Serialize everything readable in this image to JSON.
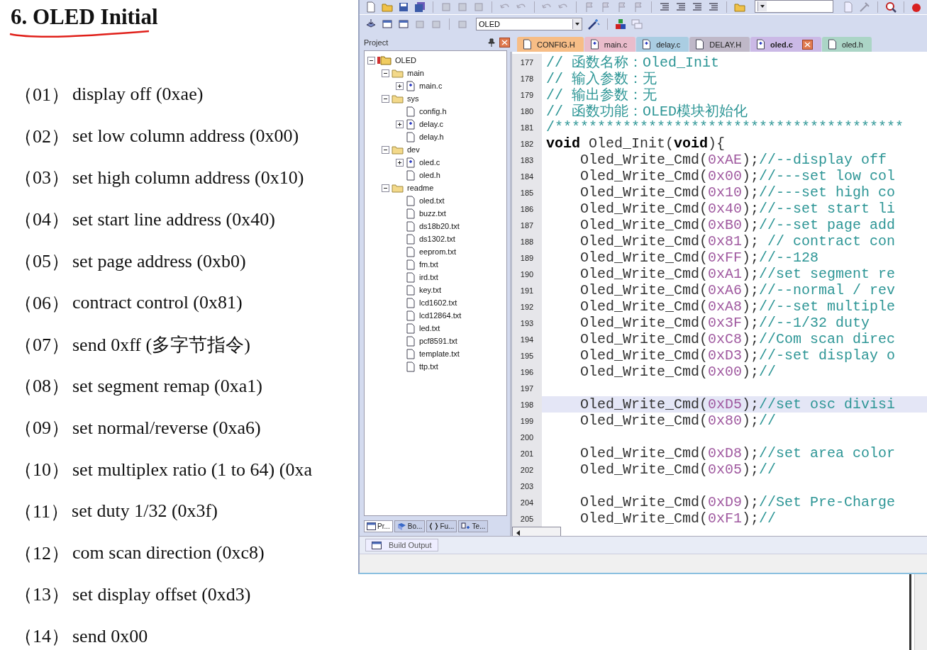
{
  "document": {
    "title": "6. OLED Initial",
    "items": [
      {
        "index": "（01）",
        "text": "display off (0xae)"
      },
      {
        "index": "（02）",
        "text": "set low column address (0x00)"
      },
      {
        "index": "（03）",
        "text": "set high column address (0x10)"
      },
      {
        "index": "（04）",
        "text": "set start line address (0x40)"
      },
      {
        "index": "（05）",
        "text": "set page address (0xb0)"
      },
      {
        "index": "（06）",
        "text": "contract control (0x81)"
      },
      {
        "index": "（07）",
        "text": "send 0xff (多字节指令)"
      },
      {
        "index": "（08）",
        "text": "set segment remap (0xa1)"
      },
      {
        "index": "（09）",
        "text": "set normal/reverse (0xa6)"
      },
      {
        "index": "（10）",
        "text": "set multiplex ratio (1 to 64) (0xa"
      },
      {
        "index": "（11）",
        "text": "set duty 1/32 (0x3f)"
      },
      {
        "index": "（12）",
        "text": "com scan direction (0xc8)"
      },
      {
        "index": "（13）",
        "text": "set display offset (0xd3)"
      },
      {
        "index": "（14）",
        "text": "send 0x00"
      }
    ]
  },
  "ide": {
    "target": "OLED",
    "project": {
      "title": "Project",
      "tree": [
        {
          "label": "OLED",
          "kind": "target",
          "expanded": true,
          "children": [
            {
              "label": "main",
              "kind": "folder",
              "expanded": true,
              "children": [
                {
                  "label": "main.c",
                  "kind": "source",
                  "expanded": false
                }
              ]
            },
            {
              "label": "sys",
              "kind": "folder",
              "expanded": true,
              "children": [
                {
                  "label": "config.h",
                  "kind": "file"
                },
                {
                  "label": "delay.c",
                  "kind": "source",
                  "expanded": false
                },
                {
                  "label": "delay.h",
                  "kind": "file"
                }
              ]
            },
            {
              "label": "dev",
              "kind": "folder",
              "expanded": true,
              "children": [
                {
                  "label": "oled.c",
                  "kind": "source",
                  "expanded": false
                },
                {
                  "label": "oled.h",
                  "kind": "file"
                }
              ]
            },
            {
              "label": "readme",
              "kind": "folder",
              "expanded": true,
              "children": [
                {
                  "label": "oled.txt",
                  "kind": "file"
                },
                {
                  "label": "buzz.txt",
                  "kind": "file"
                },
                {
                  "label": "ds18b20.txt",
                  "kind": "file"
                },
                {
                  "label": "ds1302.txt",
                  "kind": "file"
                },
                {
                  "label": "eeprom.txt",
                  "kind": "file"
                },
                {
                  "label": "fm.txt",
                  "kind": "file"
                },
                {
                  "label": "ird.txt",
                  "kind": "file"
                },
                {
                  "label": "key.txt",
                  "kind": "file"
                },
                {
                  "label": "lcd1602.txt",
                  "kind": "file"
                },
                {
                  "label": "lcd12864.txt",
                  "kind": "file"
                },
                {
                  "label": "led.txt",
                  "kind": "file"
                },
                {
                  "label": "pcf8591.txt",
                  "kind": "file"
                },
                {
                  "label": "template.txt",
                  "kind": "file"
                },
                {
                  "label": "ttp.txt",
                  "kind": "file"
                }
              ]
            }
          ]
        }
      ],
      "tabs": [
        {
          "label": "Pr...",
          "kind": "project",
          "selected": true
        },
        {
          "label": "Bo...",
          "kind": "books",
          "selected": false
        },
        {
          "label": "Fu...",
          "kind": "functions",
          "selected": false
        },
        {
          "label": "Te...",
          "kind": "templates",
          "selected": false
        }
      ]
    },
    "tabs": [
      {
        "label": "CONFIG.H",
        "kind": "file",
        "color": "#f7bd86",
        "selected": false
      },
      {
        "label": "main.c",
        "kind": "source",
        "color": "#e9bccb",
        "selected": false
      },
      {
        "label": "delay.c",
        "kind": "source",
        "color": "#aacde2",
        "selected": false
      },
      {
        "label": "DELAY.H",
        "kind": "file",
        "color": "#bfb8c8",
        "selected": false
      },
      {
        "label": "oled.c",
        "kind": "source",
        "color": "#cbb9e6",
        "selected": true
      },
      {
        "label": "oled.h",
        "kind": "file",
        "color": "#abd5c6",
        "selected": false
      }
    ],
    "code": [
      {
        "n": "177",
        "selected": false,
        "parts": [
          {
            "kind": "comment",
            "text": "// 函数名称：Oled_Init"
          }
        ]
      },
      {
        "n": "178",
        "selected": false,
        "parts": [
          {
            "kind": "comment",
            "text": "// 输入参数：无"
          }
        ]
      },
      {
        "n": "179",
        "selected": false,
        "parts": [
          {
            "kind": "comment",
            "text": "// 输出参数：无"
          }
        ]
      },
      {
        "n": "180",
        "selected": false,
        "parts": [
          {
            "kind": "comment",
            "text": "// 函数功能：OLED模块初始化"
          }
        ]
      },
      {
        "n": "181",
        "selected": false,
        "parts": [
          {
            "kind": "comment",
            "text": "/*****************************************"
          }
        ]
      },
      {
        "n": "182",
        "selected": false,
        "parts": [
          {
            "kind": "keyword",
            "text": "void"
          },
          {
            "kind": "plain",
            "text": " Oled_Init("
          },
          {
            "kind": "keyword",
            "text": "void"
          },
          {
            "kind": "plain",
            "text": "){"
          }
        ]
      },
      {
        "n": "183",
        "selected": false,
        "parts": [
          {
            "kind": "plain",
            "text": "    Oled_Write_Cmd("
          },
          {
            "kind": "number",
            "text": "0xAE"
          },
          {
            "kind": "plain",
            "text": ");"
          },
          {
            "kind": "comment",
            "text": "//--display off"
          }
        ]
      },
      {
        "n": "184",
        "selected": false,
        "parts": [
          {
            "kind": "plain",
            "text": "    Oled_Write_Cmd("
          },
          {
            "kind": "number",
            "text": "0x00"
          },
          {
            "kind": "plain",
            "text": ");"
          },
          {
            "kind": "comment",
            "text": "//---set low col"
          }
        ]
      },
      {
        "n": "185",
        "selected": false,
        "parts": [
          {
            "kind": "plain",
            "text": "    Oled_Write_Cmd("
          },
          {
            "kind": "number",
            "text": "0x10"
          },
          {
            "kind": "plain",
            "text": ");"
          },
          {
            "kind": "comment",
            "text": "//---set high co"
          }
        ]
      },
      {
        "n": "186",
        "selected": false,
        "parts": [
          {
            "kind": "plain",
            "text": "    Oled_Write_Cmd("
          },
          {
            "kind": "number",
            "text": "0x40"
          },
          {
            "kind": "plain",
            "text": ");"
          },
          {
            "kind": "comment",
            "text": "//--set start li"
          }
        ]
      },
      {
        "n": "187",
        "selected": false,
        "parts": [
          {
            "kind": "plain",
            "text": "    Oled_Write_Cmd("
          },
          {
            "kind": "number",
            "text": "0xB0"
          },
          {
            "kind": "plain",
            "text": ");"
          },
          {
            "kind": "comment",
            "text": "//--set page add"
          }
        ]
      },
      {
        "n": "188",
        "selected": false,
        "parts": [
          {
            "kind": "plain",
            "text": "    Oled_Write_Cmd("
          },
          {
            "kind": "number",
            "text": "0x81"
          },
          {
            "kind": "plain",
            "text": "); "
          },
          {
            "kind": "comment",
            "text": "// contract con"
          }
        ]
      },
      {
        "n": "189",
        "selected": false,
        "parts": [
          {
            "kind": "plain",
            "text": "    Oled_Write_Cmd("
          },
          {
            "kind": "number",
            "text": "0xFF"
          },
          {
            "kind": "plain",
            "text": ");"
          },
          {
            "kind": "comment",
            "text": "//--128"
          }
        ]
      },
      {
        "n": "190",
        "selected": false,
        "parts": [
          {
            "kind": "plain",
            "text": "    Oled_Write_Cmd("
          },
          {
            "kind": "number",
            "text": "0xA1"
          },
          {
            "kind": "plain",
            "text": ");"
          },
          {
            "kind": "comment",
            "text": "//set segment re"
          }
        ]
      },
      {
        "n": "191",
        "selected": false,
        "parts": [
          {
            "kind": "plain",
            "text": "    Oled_Write_Cmd("
          },
          {
            "kind": "number",
            "text": "0xA6"
          },
          {
            "kind": "plain",
            "text": ");"
          },
          {
            "kind": "comment",
            "text": "//--normal / rev"
          }
        ]
      },
      {
        "n": "192",
        "selected": false,
        "parts": [
          {
            "kind": "plain",
            "text": "    Oled_Write_Cmd("
          },
          {
            "kind": "number",
            "text": "0xA8"
          },
          {
            "kind": "plain",
            "text": ");"
          },
          {
            "kind": "comment",
            "text": "//--set multiple"
          }
        ]
      },
      {
        "n": "193",
        "selected": false,
        "parts": [
          {
            "kind": "plain",
            "text": "    Oled_Write_Cmd("
          },
          {
            "kind": "number",
            "text": "0x3F"
          },
          {
            "kind": "plain",
            "text": ");"
          },
          {
            "kind": "comment",
            "text": "//--1/32 duty"
          }
        ]
      },
      {
        "n": "194",
        "selected": false,
        "parts": [
          {
            "kind": "plain",
            "text": "    Oled_Write_Cmd("
          },
          {
            "kind": "number",
            "text": "0xC8"
          },
          {
            "kind": "plain",
            "text": ");"
          },
          {
            "kind": "comment",
            "text": "//Com scan direc"
          }
        ]
      },
      {
        "n": "195",
        "selected": false,
        "parts": [
          {
            "kind": "plain",
            "text": "    Oled_Write_Cmd("
          },
          {
            "kind": "number",
            "text": "0xD3"
          },
          {
            "kind": "plain",
            "text": ");"
          },
          {
            "kind": "comment",
            "text": "//-set display o"
          }
        ]
      },
      {
        "n": "196",
        "selected": false,
        "parts": [
          {
            "kind": "plain",
            "text": "    Oled_Write_Cmd("
          },
          {
            "kind": "number",
            "text": "0x00"
          },
          {
            "kind": "plain",
            "text": ");"
          },
          {
            "kind": "comment",
            "text": "//"
          }
        ]
      },
      {
        "n": "197",
        "selected": false
      },
      {
        "n": "198",
        "selected": true,
        "parts": [
          {
            "kind": "plain",
            "text": "    Oled_Write_Cmd("
          },
          {
            "kind": "number",
            "text": "0xD5"
          },
          {
            "kind": "plain",
            "text": ");"
          },
          {
            "kind": "comment",
            "text": "//set osc divisi"
          }
        ]
      },
      {
        "n": "199",
        "selected": false,
        "parts": [
          {
            "kind": "plain",
            "text": "    Oled_Write_Cmd("
          },
          {
            "kind": "number",
            "text": "0x80"
          },
          {
            "kind": "plain",
            "text": ");"
          },
          {
            "kind": "comment",
            "text": "//"
          }
        ]
      },
      {
        "n": "200",
        "selected": false
      },
      {
        "n": "201",
        "selected": false,
        "parts": [
          {
            "kind": "plain",
            "text": "    Oled_Write_Cmd("
          },
          {
            "kind": "number",
            "text": "0xD8"
          },
          {
            "kind": "plain",
            "text": ");"
          },
          {
            "kind": "comment",
            "text": "//set area color"
          }
        ]
      },
      {
        "n": "202",
        "selected": false,
        "parts": [
          {
            "kind": "plain",
            "text": "    Oled_Write_Cmd("
          },
          {
            "kind": "number",
            "text": "0x05"
          },
          {
            "kind": "plain",
            "text": ");"
          },
          {
            "kind": "comment",
            "text": "//"
          }
        ]
      },
      {
        "n": "203",
        "selected": false
      },
      {
        "n": "204",
        "selected": false,
        "parts": [
          {
            "kind": "plain",
            "text": "    Oled_Write_Cmd("
          },
          {
            "kind": "number",
            "text": "0xD9"
          },
          {
            "kind": "plain",
            "text": ");"
          },
          {
            "kind": "comment",
            "text": "//Set Pre-Charge"
          }
        ]
      },
      {
        "n": "205",
        "selected": false,
        "parts": [
          {
            "kind": "plain",
            "text": "    Oled_Write_Cmd("
          },
          {
            "kind": "number",
            "text": "0xF1"
          },
          {
            "kind": "plain",
            "text": ");"
          },
          {
            "kind": "comment",
            "text": "//"
          }
        ]
      }
    ],
    "build_output": {
      "label": "Build Output"
    }
  }
}
